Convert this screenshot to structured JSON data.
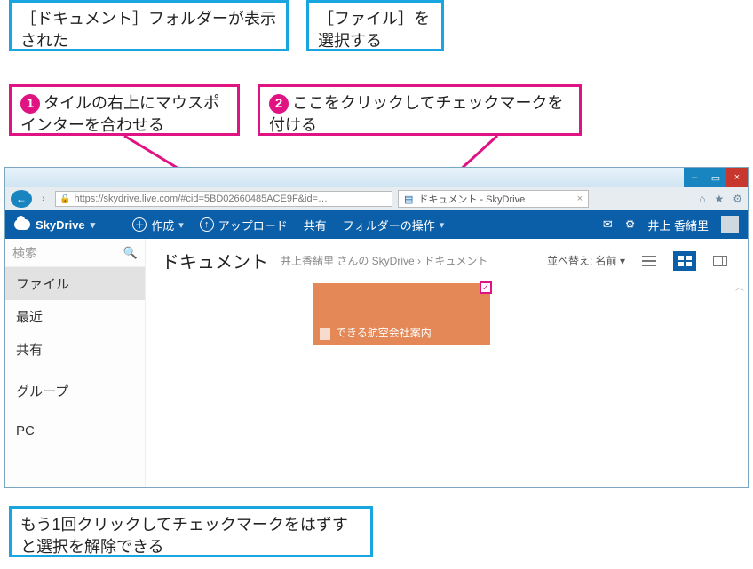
{
  "callouts": {
    "c1": "［ドキュメント］フォルダーが表示された",
    "c2": "［ファイル］を選択する",
    "c3_num": "1",
    "c3": "タイルの右上にマウスポインターを合わせる",
    "c4_num": "2",
    "c4": "ここをクリックしてチェックマークを付ける",
    "c5": "もう1回クリックしてチェックマークをはずすと選択を解除できる"
  },
  "window": {
    "url": "https://skydrive.live.com/#cid=5BD02660485ACE9F&id=…",
    "tabTitle": "ドキュメント - SkyDrive",
    "min": "–",
    "max": "▭",
    "close": "×",
    "home": "⌂",
    "star": "★",
    "gear": "⚙"
  },
  "band": {
    "product": "SkyDrive",
    "create": "作成",
    "createIcon": "＋",
    "upload": "アップロード",
    "uploadIcon": "↑",
    "share": "共有",
    "manage": "フォルダーの操作",
    "manageChev": "▾",
    "msgIcon": "✉",
    "settingsIcon": "⚙",
    "user": "井上 香緒里"
  },
  "sidebar": {
    "searchPlaceholder": "検索",
    "items": [
      "ファイル",
      "最近",
      "共有",
      "グループ",
      "PC"
    ],
    "activeIndex": 0
  },
  "main": {
    "title": "ドキュメント",
    "breadcrumb": "井上香緒里 さんの SkyDrive › ドキュメント",
    "sortLabel": "並べ替え: 名前",
    "sortChev": "▾",
    "tileName": "できる航空会社案内",
    "tileCheck": "✓"
  }
}
